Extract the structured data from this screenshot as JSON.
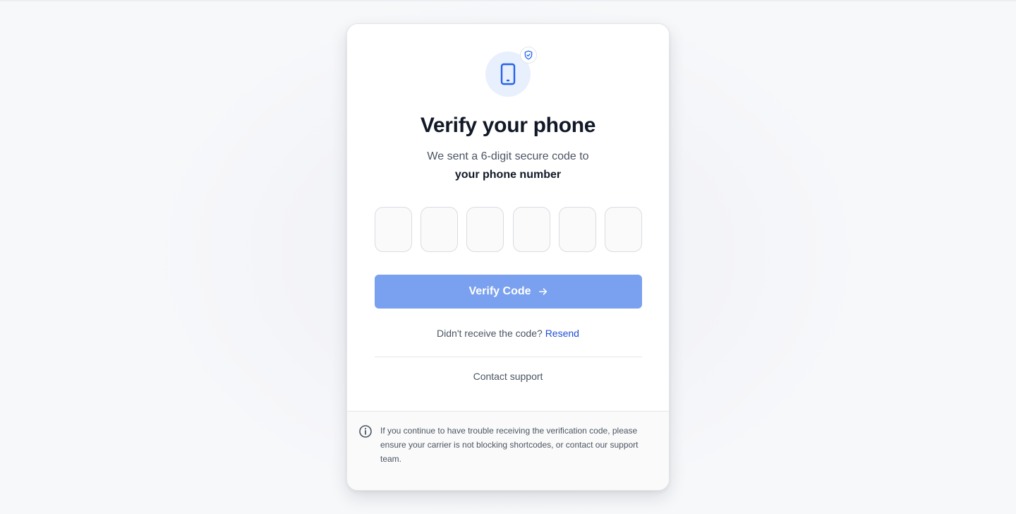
{
  "card": {
    "title": "Verify your phone",
    "subtitle": "We sent a 6-digit secure code to",
    "recipient": "your phone number",
    "otp": {
      "digits": [
        "",
        "",
        "",
        "",
        "",
        ""
      ]
    },
    "verify_button": {
      "label": "Verify Code",
      "icon": "arrow-right-icon",
      "color": "#7aa0f0"
    },
    "resend": {
      "prompt": "Didn't receive the code?",
      "link_label": "Resend",
      "link_color": "#1d4ed8"
    },
    "support_link": "Contact support",
    "footer_note": "If you continue to have trouble receiving the verification code, please ensure your carrier is not blocking shortcodes, or contact our support team.",
    "icons": {
      "main": "smartphone-icon",
      "badge": "shield-check-icon",
      "note": "info-icon"
    }
  },
  "colors": {
    "accent": "#2563eb",
    "icon_bg": "#e8effd",
    "title": "#111827",
    "text_muted": "#4b5563"
  }
}
